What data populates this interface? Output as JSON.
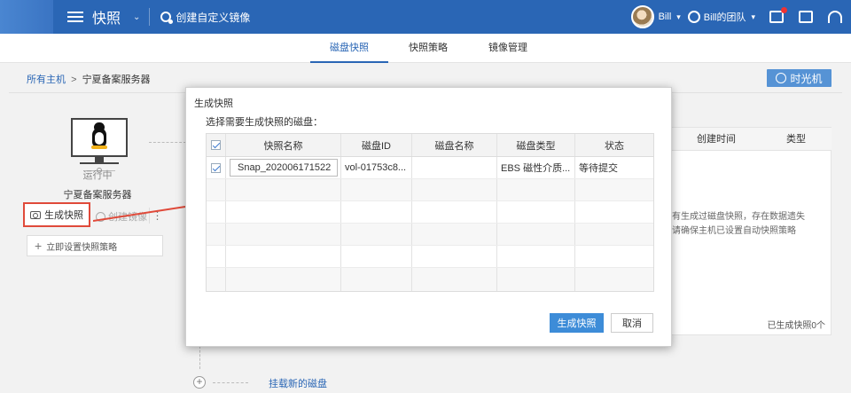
{
  "topbar": {
    "title": "快照",
    "create_label": "创建自定义镜像",
    "user": "Bill",
    "team": "Bill的团队"
  },
  "tabs": [
    "磁盘快照",
    "快照策略",
    "镜像管理"
  ],
  "breadcrumb": {
    "root": "所有主机",
    "separator": ">",
    "current": "宁夏备案服务器"
  },
  "timemachine_label": "时光机",
  "host": {
    "status": "运行中",
    "name": "宁夏备案服务器",
    "snapshot_button": "生成快照",
    "image_button": "创建镜像",
    "more": "⋮",
    "policy_button": "立即设置快照策略"
  },
  "mount_link": "挂载新的磁盘",
  "background_table": {
    "headers": [
      "创建时间",
      "类型"
    ],
    "note_line1": "有生成过磁盘快照，存在数据遗失",
    "note_line2": "请确保主机已设置自动快照策略",
    "count": "已生成快照0个"
  },
  "modal": {
    "title": "生成快照",
    "subtitle": "选择需要生成快照的磁盘：",
    "columns": [
      "快照名称",
      "磁盘ID",
      "磁盘名称",
      "磁盘类型",
      "状态"
    ],
    "row": {
      "snapshot_name": "Snap_202006171522",
      "disk_id": "vol-01753c8...",
      "disk_name": "",
      "disk_type": "EBS 磁性介质...",
      "status": "等待提交"
    },
    "confirm": "生成快照",
    "cancel": "取消"
  }
}
